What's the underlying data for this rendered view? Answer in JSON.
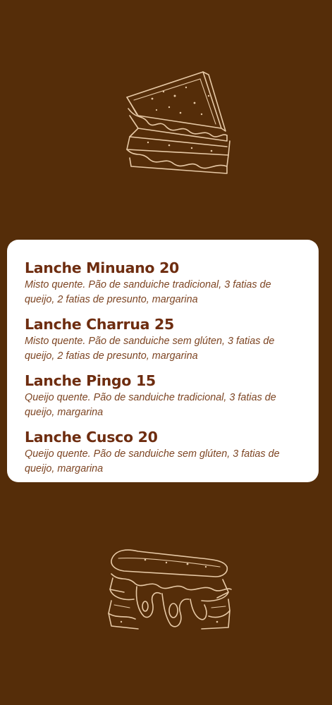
{
  "menu": {
    "items": [
      {
        "name": "Lanche Minuano",
        "price": "20",
        "description": "Misto quente. Pão de sanduiche tradicional, 3 fatias de queijo, 2 fatias de presunto, margarina"
      },
      {
        "name": "Lanche Charrua",
        "price": "25",
        "description": "Misto quente. Pão de sanduiche sem glúten, 3 fatias de queijo, 2 fatias de presunto, margarina"
      },
      {
        "name": "Lanche Pingo",
        "price": "15",
        "description": "Queijo quente. Pão de sanduiche tradicional, 3 fatias de queijo, margarina"
      },
      {
        "name": "Lanche Cusco",
        "price": "20",
        "description": "Queijo quente. Pão de sanduiche sem glúten, 3 fatias de queijo, margarina"
      }
    ]
  },
  "illustrations": {
    "top": "stacked-sandwich-triangles-icon",
    "bottom": "melted-cheese-sandwich-icon"
  },
  "colors": {
    "background": "#552d09",
    "card": "#ffffff",
    "title": "#6e2d10",
    "description": "#7d4523",
    "sketch": "#e7c9a6"
  }
}
